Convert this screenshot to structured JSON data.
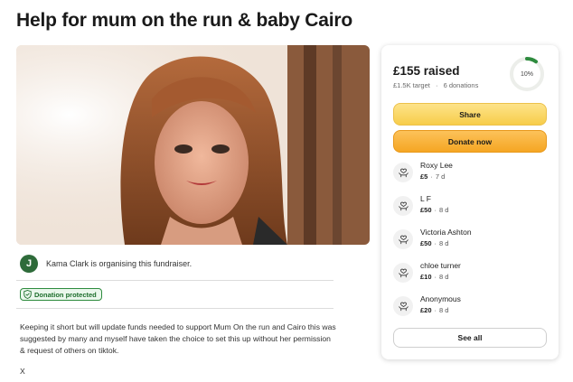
{
  "page": {
    "title": "Help for mum on the run & baby Cairo"
  },
  "organiser": {
    "initial": "J",
    "text": "Kama Clark is organising this fundraiser."
  },
  "badge": {
    "label": "Donation protected"
  },
  "story": {
    "body": "Keeping it short but will update funds needed to support Mum On the run and Cairo this was suggested by many and myself have taken the choice to set this up without her permission & request of others on tiktok.",
    "sign_off": "X"
  },
  "donation_card": {
    "raised": "£155 raised",
    "target": "£1.5K target",
    "separator": "·",
    "donation_count": "6 donations",
    "progress_percent_label": "10%",
    "progress_fraction": 0.1,
    "share_label": "Share",
    "donate_label": "Donate now",
    "see_all_label": "See all",
    "donors": [
      {
        "name": "Roxy Lee",
        "amount": "£5",
        "sep": "·",
        "time": "7 d"
      },
      {
        "name": "L F",
        "amount": "£50",
        "sep": "·",
        "time": "8 d"
      },
      {
        "name": "Victoria Ashton",
        "amount": "£50",
        "sep": "·",
        "time": "8 d"
      },
      {
        "name": "chloe turner",
        "amount": "£10",
        "sep": "·",
        "time": "8 d"
      },
      {
        "name": "Anonymous",
        "amount": "£20",
        "sep": "·",
        "time": "8 d"
      }
    ]
  },
  "colors": {
    "accent_green": "#2e8b3e",
    "donate_orange": "#f5a623",
    "share_yellow": "#f7cd4a"
  },
  "icons": {
    "badge": "shield-check-icon",
    "donor": "heart-hands-icon"
  }
}
